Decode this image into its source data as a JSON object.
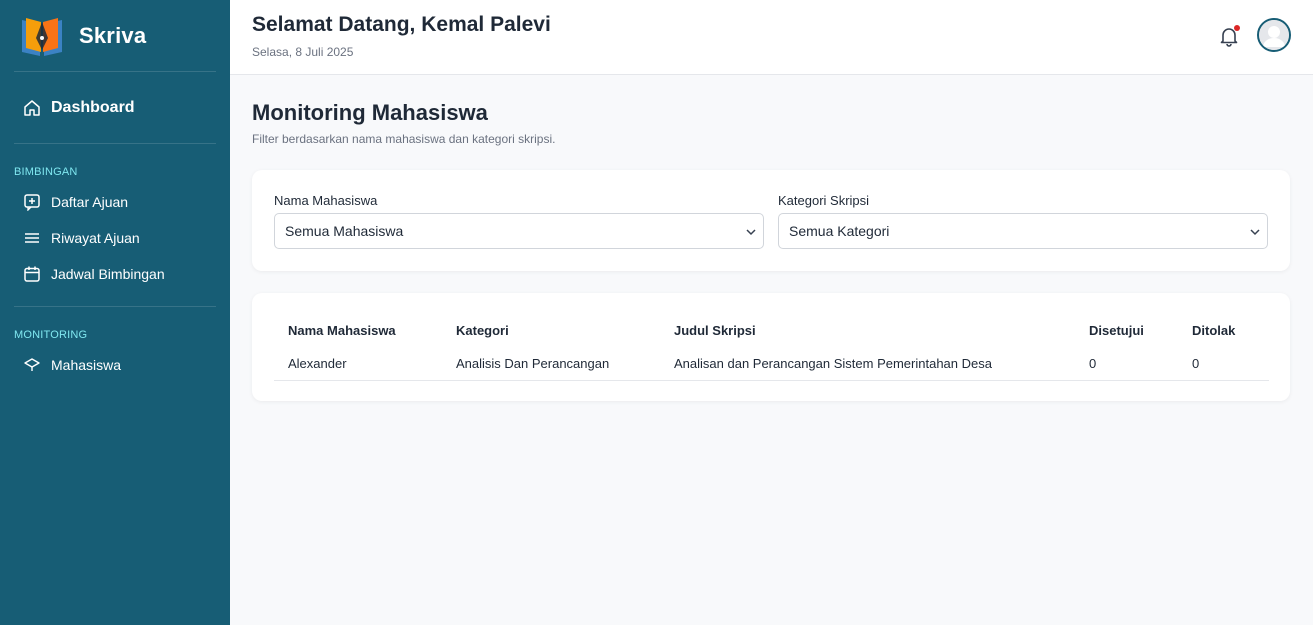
{
  "brand": {
    "name": "Skriva"
  },
  "sidebar": {
    "dashboard": "Dashboard",
    "section_bimbingan": "BIMBINGAN",
    "items_bimbingan": [
      "Daftar Ajuan",
      "Riwayat Ajuan",
      "Jadwal Bimbingan"
    ],
    "section_monitoring": "MONITORING",
    "items_monitoring": [
      "Mahasiswa"
    ]
  },
  "header": {
    "welcome": "Selamat Datang, Kemal Palevi",
    "date": "Selasa, 8 Juli 2025",
    "notification_icon": "bell-icon",
    "has_notification": true
  },
  "page": {
    "title": "Monitoring Mahasiswa",
    "subtitle": "Filter berdasarkan nama mahasiswa dan kategori skripsi."
  },
  "filters": {
    "nama_label": "Nama Mahasiswa",
    "nama_value": "Semua Mahasiswa",
    "kategori_label": "Kategori Skripsi",
    "kategori_value": "Semua Kategori"
  },
  "table": {
    "headers": [
      "Nama Mahasiswa",
      "Kategori",
      "Judul Skripsi",
      "Disetujui",
      "Ditolak"
    ],
    "rows": [
      [
        "Alexander",
        "Analisis Dan Perancangan",
        "Analisan dan Perancangan Sistem Pemerintahan Desa",
        "0",
        "0"
      ]
    ]
  },
  "colors": {
    "sidebar_bg": "#175d75",
    "section_label": "#7fe7f0",
    "notification_dot": "#dc2626"
  }
}
